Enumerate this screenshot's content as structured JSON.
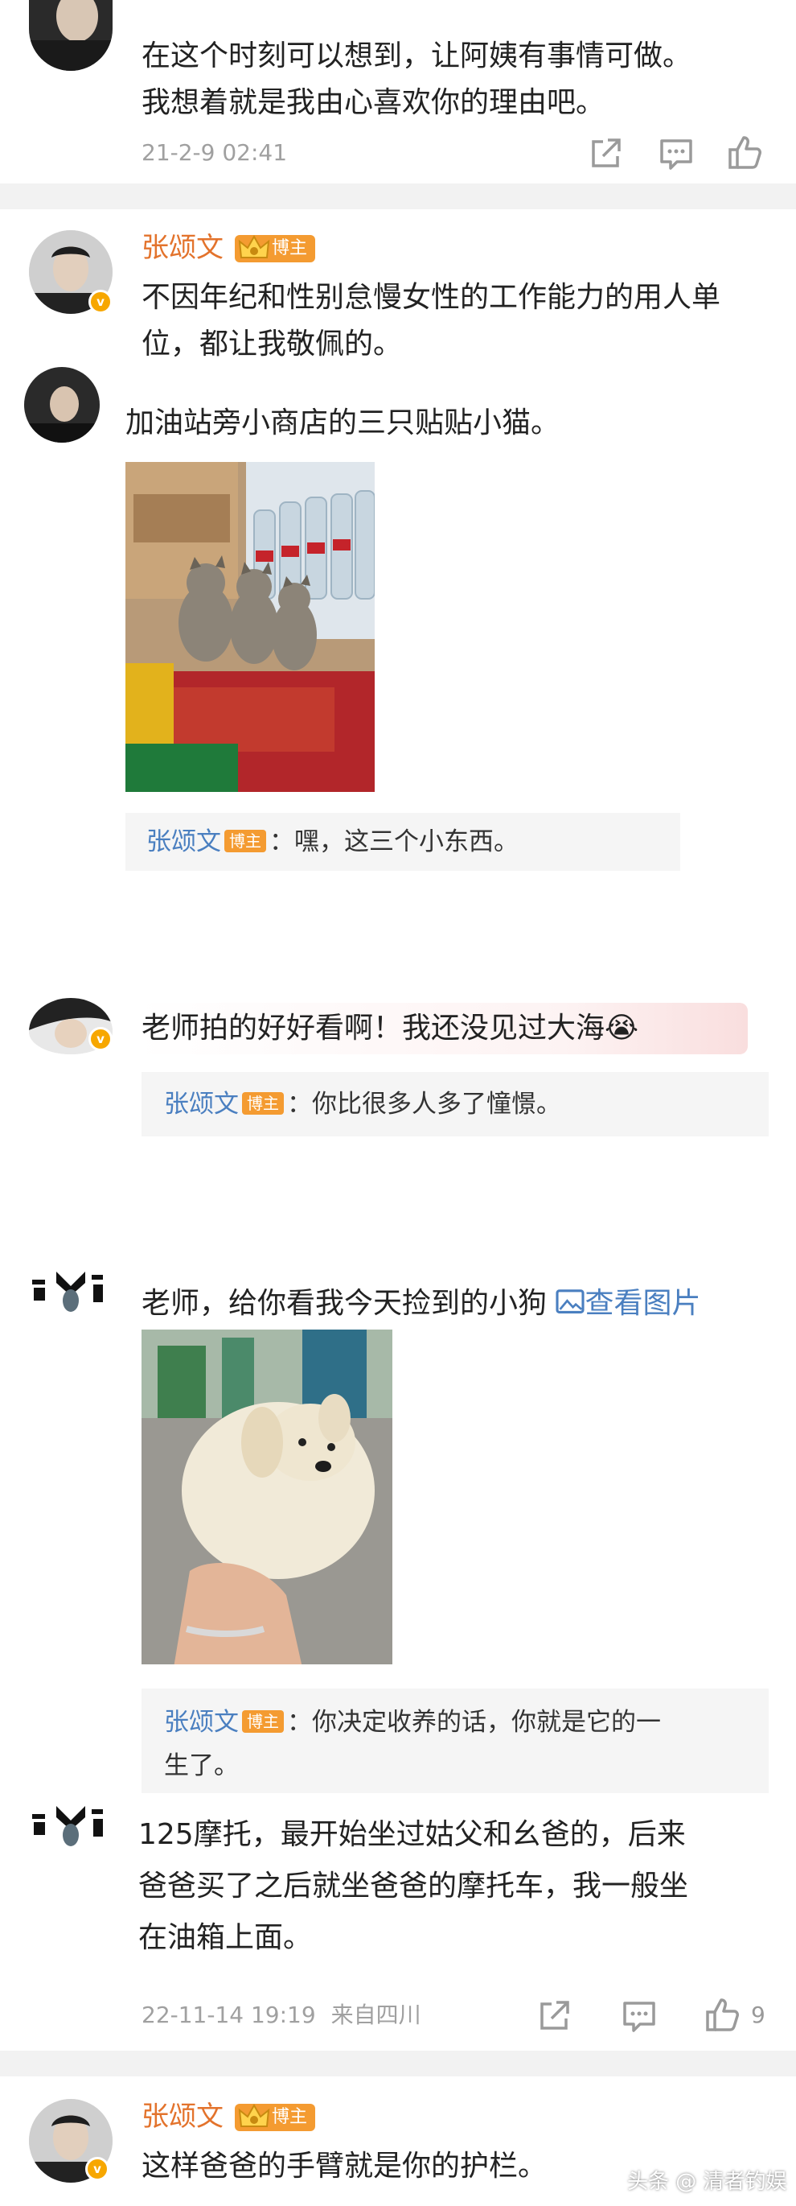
{
  "comment1": {
    "line1": "在这个时刻可以想到，让阿姨有事情可做。",
    "line2": "我想着就是我由心喜欢你的理由吧。",
    "timestamp": "21-2-9 02:41"
  },
  "comment2": {
    "author": "张颂文",
    "badge": "博主",
    "line1": "不因年纪和性别怠慢女性的工作能力的用人单",
    "line2": "位，都让我敬佩的。"
  },
  "comment3": {
    "text": "加油站旁小商店的三只贴贴小猫。",
    "reply": {
      "name": "张颂文",
      "badge": "博主",
      "text": "：嘿，这三个小东西。"
    }
  },
  "comment4": {
    "text": "老师拍的好好看啊！我还没见过大海",
    "emoji": "😭",
    "reply": {
      "name": "张颂文",
      "badge": "博主",
      "text": "：你比很多人多了憧憬。"
    }
  },
  "comment5": {
    "text": "老师，给你看我今天捡到的小狗",
    "view_image_label": "查看图片",
    "reply": {
      "name": "张颂文",
      "badge": "博主",
      "text_line1": "：你决定收养的话，你就是它的一",
      "text_line2": "生了。"
    }
  },
  "comment6": {
    "line1": "125摩托，最开始坐过姑父和幺爸的，后来",
    "line2": "爸爸买了之后就坐爸爸的摩托车，我一般坐",
    "line3": "在油箱上面。",
    "timestamp": "22-11-14 19:19",
    "location": "来自四川",
    "like_count": "9"
  },
  "comment7": {
    "author": "张颂文",
    "badge": "博主",
    "text": "这样爸爸的手臂就是你的护栏。"
  },
  "watermark": "头条 @ 清者钓娱",
  "icons": {
    "share": "share-icon",
    "comment": "comment-icon",
    "like": "thumbs-up-icon",
    "verified": "verified-badge-icon",
    "image_link": "image-icon"
  },
  "colors": {
    "author_orange": "#e3732c",
    "badge_orange": "#f49b31",
    "link_blue": "#4a7fc0",
    "reply_bg": "#f5f5f5",
    "separator": "#f2f2f2"
  }
}
